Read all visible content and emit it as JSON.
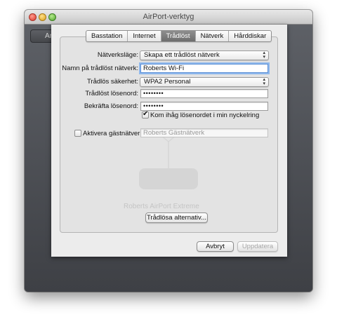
{
  "window": {
    "title": "AirPort-verktyg",
    "background_button_label": "An"
  },
  "tabs": [
    {
      "label": "Basstation",
      "active": false
    },
    {
      "label": "Internet",
      "active": false
    },
    {
      "label": "Trådlöst",
      "active": true
    },
    {
      "label": "Nätverk",
      "active": false
    },
    {
      "label": "Hårddiskar",
      "active": false
    }
  ],
  "form": {
    "network_mode": {
      "label": "Nätverksläge:",
      "value": "Skapa ett trådlöst nätverk"
    },
    "network_name": {
      "label": "Namn på trådlöst nätverk:",
      "value": "Roberts Wi-Fi"
    },
    "security": {
      "label": "Trådlös säkerhet:",
      "value": "WPA2 Personal"
    },
    "password": {
      "label": "Trådlöst lösenord:",
      "value": "••••••••"
    },
    "confirm_password": {
      "label": "Bekräfta lösenord:",
      "value": "••••••••"
    },
    "remember_keychain": {
      "label": "Kom ihåg lösenordet i min nyckelring",
      "checked": true
    },
    "guest_network": {
      "label": "Aktivera gästnätverk:",
      "checked": false,
      "placeholder": "Roberts Gästnätverk"
    }
  },
  "wireless_options_button": "Trådlösa alternativ...",
  "watermark_text": "Roberts AirPort Extreme",
  "buttons": {
    "cancel": "Avbryt",
    "update": "Uppdatera"
  },
  "icons": {
    "popup_arrows": "up-down-arrows-icon",
    "checkmark": "checkmark-icon",
    "watermark": "airport-extreme-icon"
  }
}
